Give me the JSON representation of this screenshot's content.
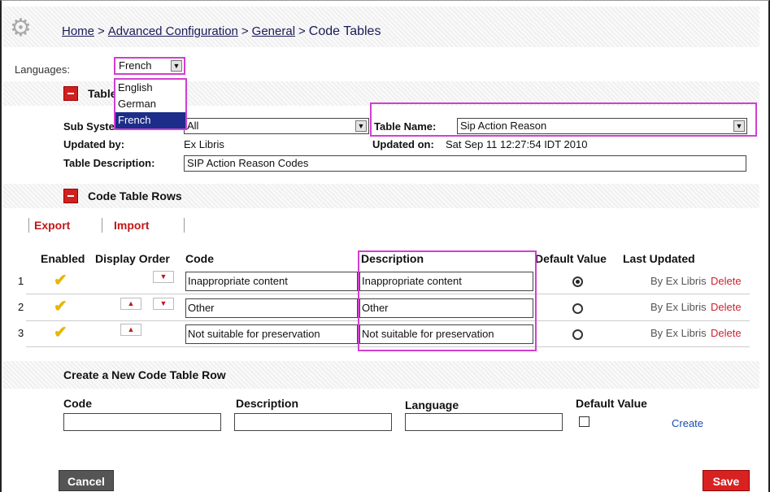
{
  "breadcrumb": {
    "home": "Home",
    "advanced": "Advanced Configuration",
    "general": "General",
    "current": "Code Tables",
    "separator": ">"
  },
  "languages": {
    "label": "Languages:",
    "selected": "French",
    "options": [
      "English",
      "German",
      "French"
    ]
  },
  "table_definition": {
    "title": "Table Definition",
    "subsystem_label": "Sub System:",
    "subsystem_value": "All",
    "table_name_label": "Table Name:",
    "table_name_value": "Sip Action Reason",
    "updated_by_label": "Updated by:",
    "updated_by_value": "Ex Libris",
    "updated_on_label": "Updated on:",
    "updated_on_value": "Sat Sep 11 12:27:54 IDT 2010",
    "description_label": "Table Description:",
    "description_value": "SIP Action Reason Codes"
  },
  "rows_section": {
    "title": "Code Table Rows",
    "export": "Export",
    "import": "Import",
    "columns": [
      "Enabled",
      "Display Order",
      "Code",
      "Description",
      "Default Value",
      "Last Updated"
    ],
    "rows": [
      {
        "num": "1",
        "code": "Inappropriate content",
        "description": "Inappropriate content",
        "updated": "By Ex Libris",
        "delete": "Delete",
        "default": true
      },
      {
        "num": "2",
        "code": "Other",
        "description": "Other",
        "updated": "By Ex Libris",
        "delete": "Delete",
        "default": false
      },
      {
        "num": "3",
        "code": "Not suitable for preservation",
        "description": "Not suitable for preservation",
        "updated": "By Ex Libris",
        "delete": "Delete",
        "default": false
      }
    ]
  },
  "new_row": {
    "title": "Create a New Code Table Row",
    "code_label": "Code",
    "description_label": "Description",
    "language_label": "Language",
    "default_label": "Default Value",
    "create": "Create"
  },
  "buttons": {
    "cancel": "Cancel",
    "save": "Save"
  },
  "colors": {
    "accent_red": "#d82222",
    "highlight": "#d040d0",
    "link_blue": "#1a4ab0"
  }
}
